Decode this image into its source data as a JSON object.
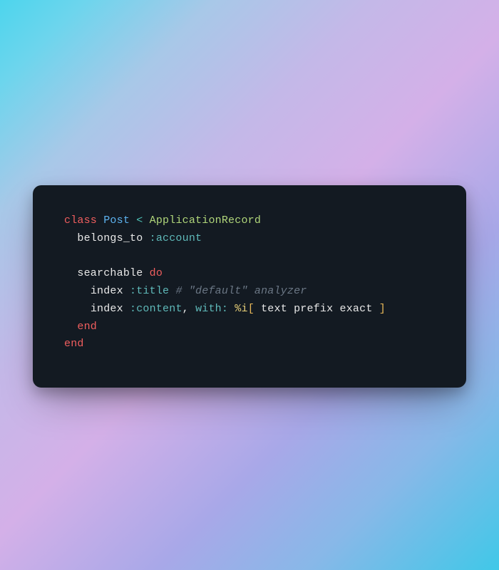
{
  "code": {
    "line1": {
      "class_kw": "class",
      "class_name": "Post",
      "inherit_op": "<",
      "parent_class": "ApplicationRecord"
    },
    "line2": {
      "method": "belongs_to",
      "symbol": ":account"
    },
    "line3": {
      "method": "searchable",
      "do_kw": "do"
    },
    "line4": {
      "method": "index",
      "symbol": ":title",
      "comment": "# \"default\" analyzer"
    },
    "line5": {
      "method": "index",
      "symbol": ":content",
      "comma": ",",
      "with_key": "with:",
      "percent": "%i",
      "open_bracket": "[",
      "items": " text prefix exact ",
      "close_bracket": "]"
    },
    "line6": {
      "end_kw": "end"
    },
    "line7": {
      "end_kw": "end"
    }
  }
}
